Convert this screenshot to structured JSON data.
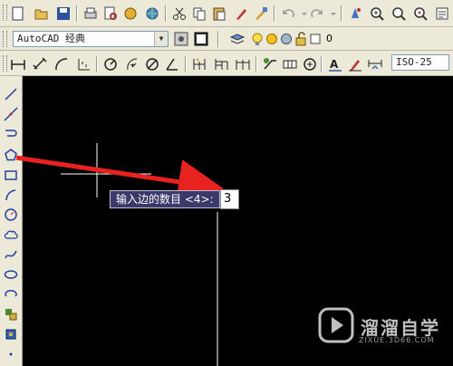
{
  "toolbar_row2": {
    "workspace_combo": "AutoCAD 经典",
    "layer_value": "0"
  },
  "toolbar_row3": {
    "dimstyle_combo": "ISO-25"
  },
  "command_prompt": {
    "label": "输入边的数目 <4>:",
    "input_value": "3"
  },
  "watermark": {
    "text": "溜溜自学",
    "url": "ZIXUE.3D66.COM"
  },
  "colors": {
    "canvas_background": "#000000",
    "annotation_arrow": "#e8231f",
    "prompt_background": "#3a3a6a"
  }
}
